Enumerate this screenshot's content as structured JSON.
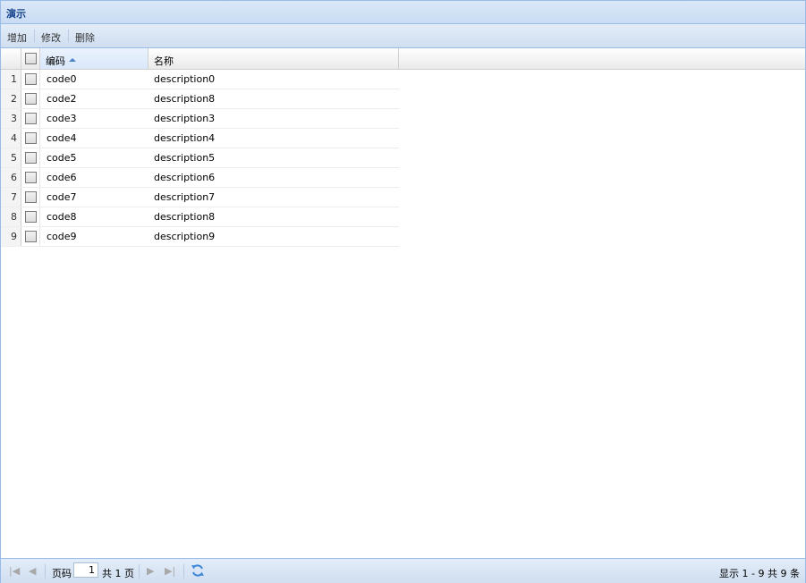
{
  "panel": {
    "title": "演示"
  },
  "toolbar": {
    "add_label": "增加",
    "edit_label": "修改",
    "delete_label": "删除"
  },
  "grid": {
    "columns": [
      {
        "label": "编码",
        "sorted": "asc"
      },
      {
        "label": "名称"
      }
    ],
    "rows": [
      {
        "num": "1",
        "code": "code0",
        "name": "description0"
      },
      {
        "num": "2",
        "code": "code2",
        "name": "description8"
      },
      {
        "num": "3",
        "code": "code3",
        "name": "description3"
      },
      {
        "num": "4",
        "code": "code4",
        "name": "description4"
      },
      {
        "num": "5",
        "code": "code5",
        "name": "description5"
      },
      {
        "num": "6",
        "code": "code6",
        "name": "description6"
      },
      {
        "num": "7",
        "code": "code7",
        "name": "description7"
      },
      {
        "num": "8",
        "code": "code8",
        "name": "description8"
      },
      {
        "num": "9",
        "code": "code9",
        "name": "description9"
      }
    ]
  },
  "pager": {
    "page_label": "页码",
    "page_value": "1",
    "total_pages_label": "共 1 页",
    "summary": "显示 1 - 9 共 9 条"
  },
  "colors": {
    "accent": "#15428b",
    "border": "#99bbe8",
    "sort_icon": "#4b82c4"
  }
}
